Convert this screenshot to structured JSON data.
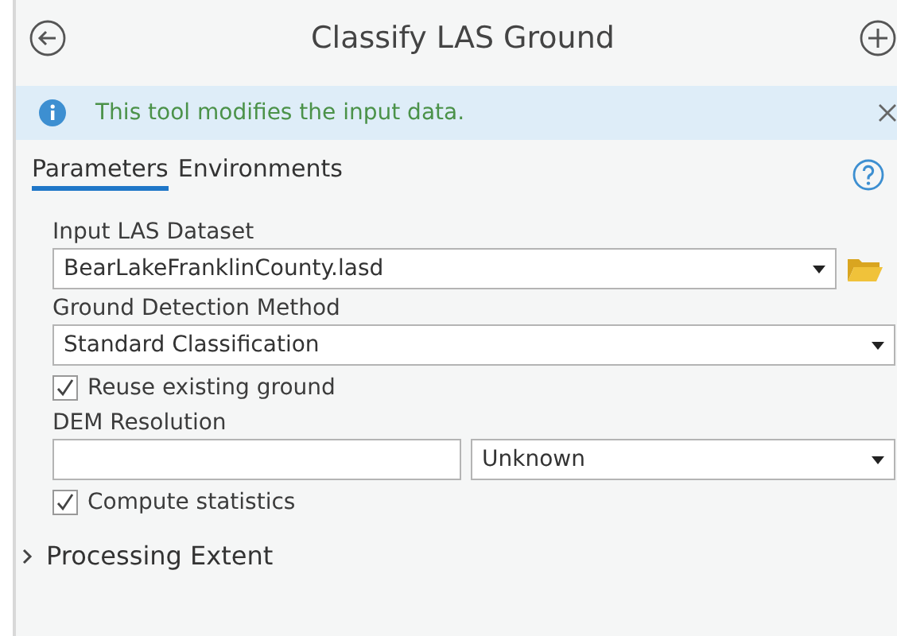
{
  "header": {
    "title": "Classify LAS Ground"
  },
  "banner": {
    "message": "This tool modifies the input data.",
    "closable": true
  },
  "tabs": [
    {
      "label": "Parameters",
      "selected": true
    },
    {
      "label": "Environments",
      "selected": false
    }
  ],
  "parameters": [
    {
      "kind": "dropdown",
      "label": "Input LAS Dataset",
      "value": "BearLakeFranklinCounty.lasd",
      "browse": true
    },
    {
      "kind": "dropdown",
      "label": "Ground Detection Method",
      "value": "Standard Classification",
      "browse": false
    },
    {
      "kind": "checkbox",
      "label": "Reuse existing ground",
      "checked": true
    },
    {
      "kind": "linear-unit",
      "label": "DEM Resolution",
      "unit": "Unknown"
    },
    {
      "kind": "checkbox",
      "label": "Compute statistics",
      "checked": true
    }
  ],
  "sections": [
    {
      "label": "Processing Extent",
      "expanded": false
    }
  ]
}
